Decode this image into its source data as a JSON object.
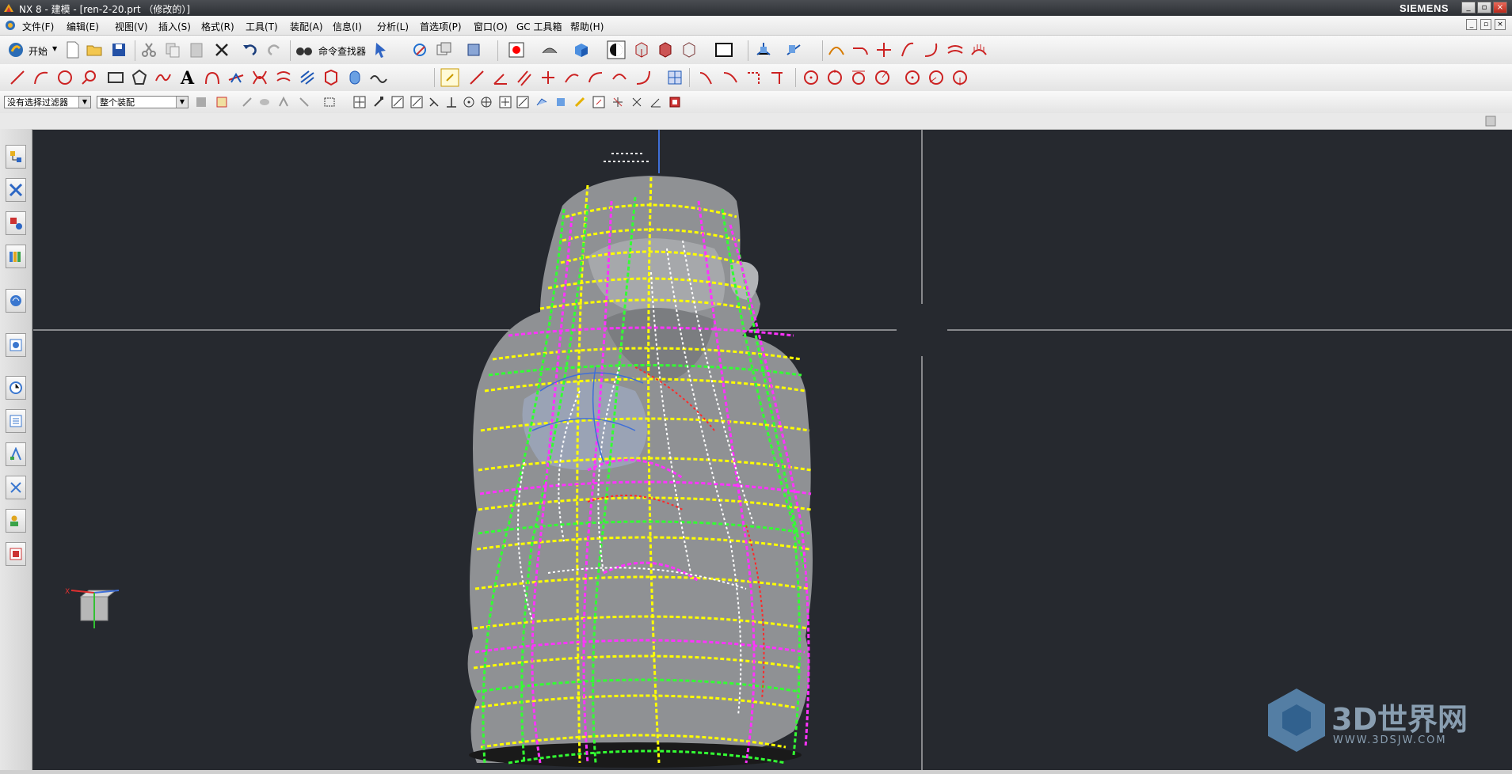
{
  "window": {
    "title": "NX 8 - 建模 - [ren-2-20.prt （修改的）]",
    "brand": "SIEMENS"
  },
  "menu": [
    "文件(F)",
    "编辑(E)",
    "视图(V)",
    "插入(S)",
    "格式(R)",
    "工具(T)",
    "装配(A)",
    "信息(I)",
    "分析(L)",
    "首选项(P)",
    "窗口(O)",
    "GC 工具箱",
    "帮助(H)"
  ],
  "toolbar": {
    "start_label": "开始",
    "command_finder_label": "命令查找器"
  },
  "selection": {
    "filter_value": "没有选择过滤器",
    "scope_value": "整个装配"
  },
  "watermark": {
    "brand": "3D世界网",
    "url": "WWW.3DSJW.COM"
  },
  "colors": {
    "viewport_bg": "#26292f",
    "curve_yellow": "#ffff00",
    "curve_green": "#33ff33",
    "curve_magenta": "#ff33ff",
    "curve_white": "#ffffff",
    "model_gray": "#8f9194"
  }
}
